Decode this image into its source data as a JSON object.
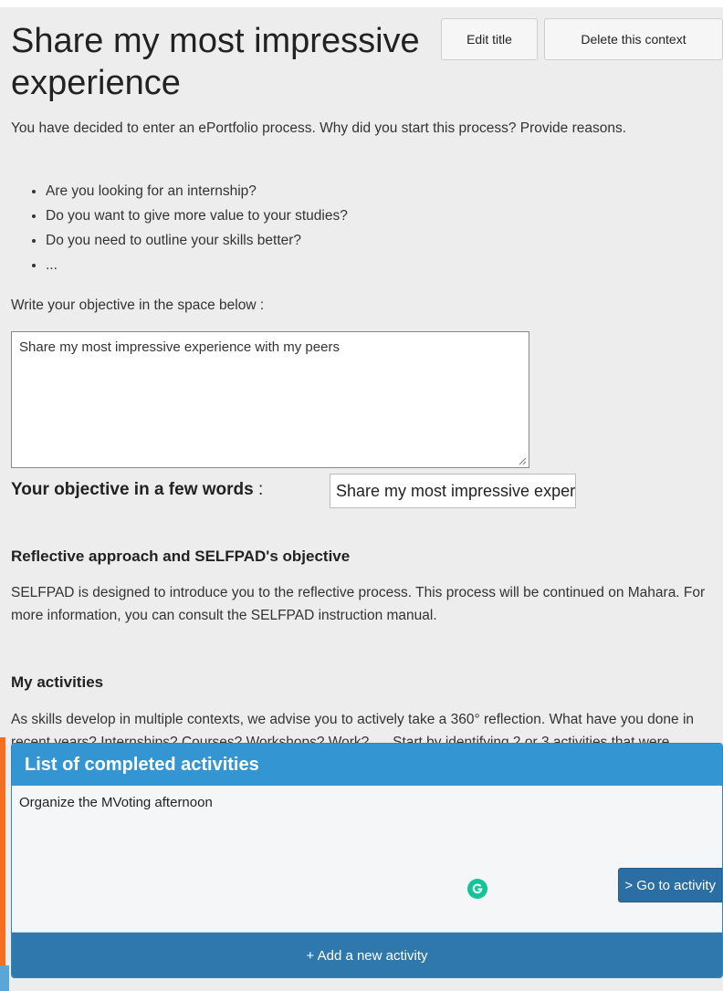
{
  "header": {
    "title": "Share my most impressive experience",
    "edit_title_label": "Edit title",
    "delete_context_label": "Delete this context"
  },
  "intro": {
    "text": "You have decided to enter an ePortfolio process. Why did you start this process? Provide reasons.",
    "bullets": [
      "Are you looking for an internship?",
      "Do you want to give more value to your studies?",
      "Do you need to outline your skills better?",
      "..."
    ]
  },
  "objective": {
    "prompt": "Write your objective in the space below :",
    "value": "Share my most impressive experience with my peers",
    "short_label": "Your objective in a few words",
    "short_sep": " :",
    "short_value": "Share my most impressive experience with my peers"
  },
  "reflective": {
    "heading": "Reflective approach and SELFPAD's objective",
    "text": "SELFPAD is designed to introduce you to the reflective process. This process will be continued on Mahara. For more information, you can consult the SELFPAD instruction manual."
  },
  "activities_section": {
    "heading": "My activities",
    "text": "As skills develop in multiple contexts, we advise you to actively take a 360° reflection. What have you done in recent years? Internships? Courses? Workshops? Work?... . Start by identifying 2 or 3 activities that were particularly rewarding."
  },
  "activity_list": {
    "title": "List of completed activities",
    "items": [
      {
        "name": "Organize the MVoting afternoon",
        "go_label": "> Go to activity"
      }
    ],
    "add_label": "+ Add a new activity"
  },
  "colors": {
    "panel_header": "#3396d3",
    "add_button": "#2f78ad",
    "accent_orange": "#f36f21",
    "grammarly_green": "#15c39a"
  },
  "icons": [
    "resize-grip-icon",
    "grammarly-icon"
  ]
}
